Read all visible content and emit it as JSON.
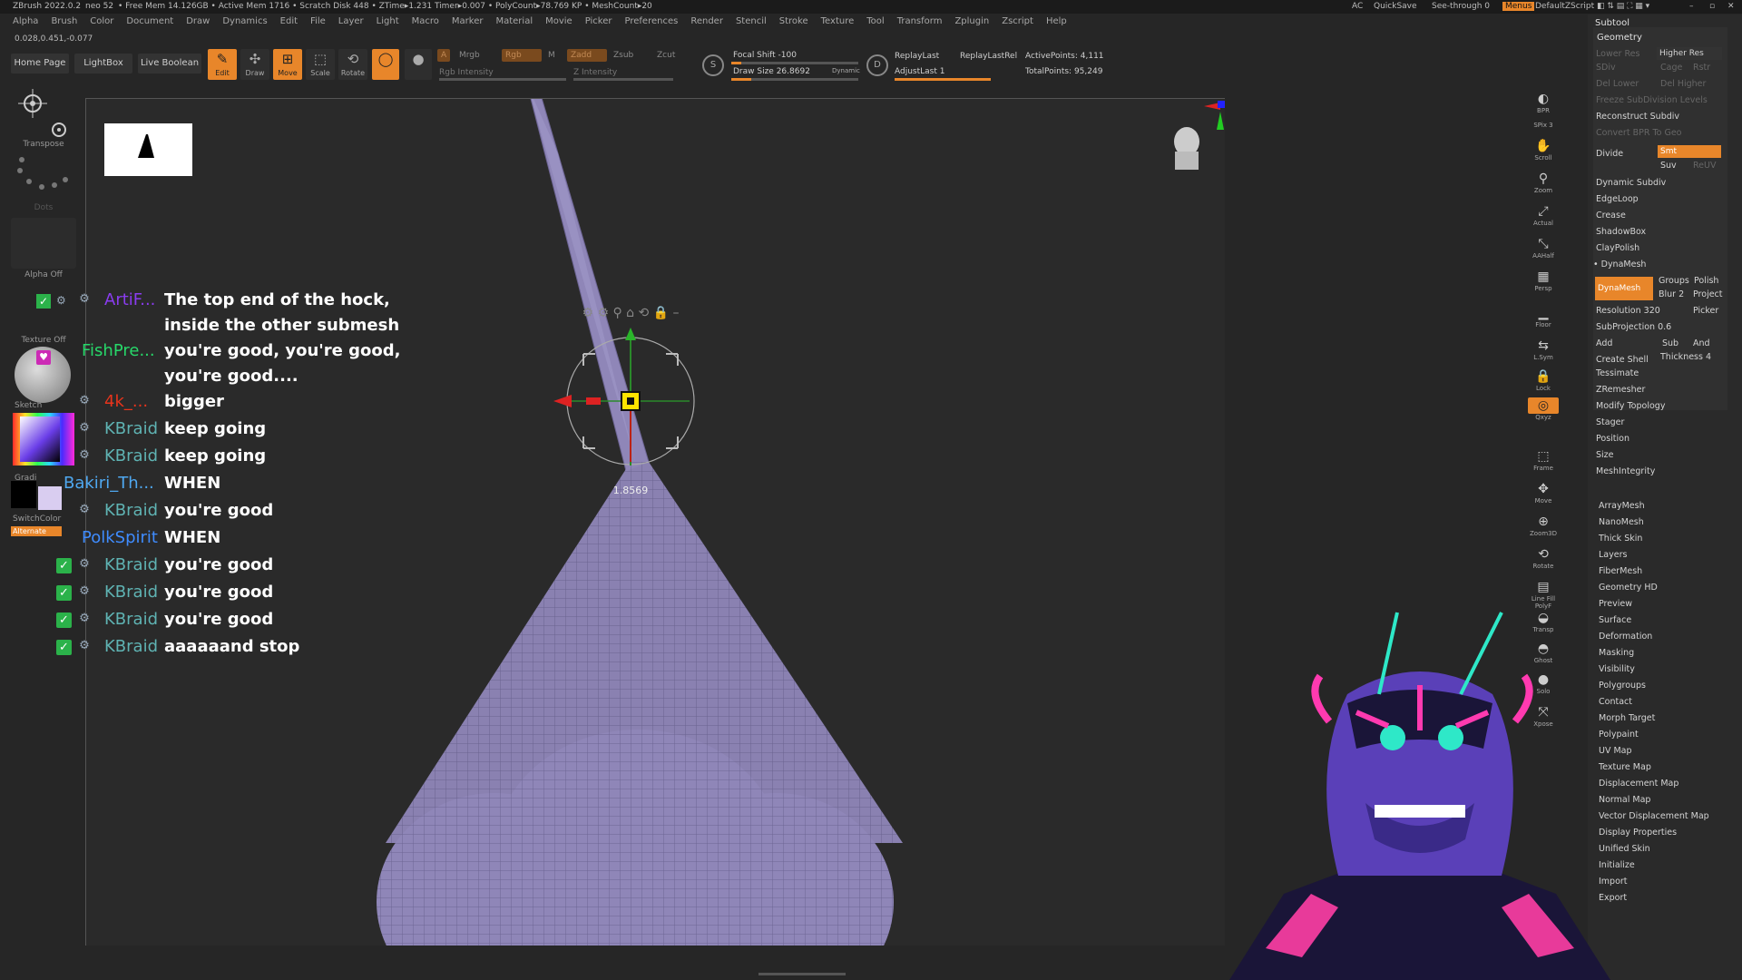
{
  "titlebar": {
    "app": "ZBrush 2022.0.2",
    "user": "neo 52",
    "stats": "• Free Mem 14.126GB • Active Mem 1716 • Scratch Disk 448 • ZTime▸1.231 Timer▸0.007 • PolyCount▸78.769 KP • MeshCount▸20",
    "ac": "AC",
    "quicksave": "QuickSave",
    "seethrough": "See-through  0",
    "menus": "Menus",
    "script": "DefaultZScript"
  },
  "menubar": [
    "Alpha",
    "Brush",
    "Color",
    "Document",
    "Draw",
    "Dynamics",
    "Edit",
    "File",
    "Layer",
    "Light",
    "Macro",
    "Marker",
    "Material",
    "Movie",
    "Picker",
    "Preferences",
    "Render",
    "Stencil",
    "Stroke",
    "Texture",
    "Tool",
    "Transform",
    "Zplugin",
    "Zscript",
    "Help"
  ],
  "coords": "0.028,0.451,-0.077",
  "toolbar": {
    "home_page": "Home Page",
    "lightbox": "LightBox",
    "live_boolean": "Live Boolean",
    "edit": "Edit",
    "draw": "Draw",
    "move": "Move",
    "scale": "Scale",
    "rotate": "Rotate",
    "a_btn": "A",
    "mrgb": "Mrgb",
    "rgb": "Rgb",
    "m": "M",
    "zadd": "Zadd",
    "zsub": "Zsub",
    "zcut": "Zcut",
    "rgb_intensity": "Rgb Intensity",
    "z_intensity": "Z Intensity",
    "focal_shift": "Focal Shift -100",
    "draw_size": "Draw Size 26.8692",
    "dynamic": "Dynamic",
    "replay_last": "ReplayLast",
    "replay_last_rel": "ReplayLastRel",
    "adjust_last": "AdjustLast 1",
    "active_points": "ActivePoints: 4,111",
    "total_points": "TotalPoints: 95,249",
    "s_label": "S",
    "d_label": "D"
  },
  "lefttray": {
    "transpose": "Transpose",
    "dots": "Dots",
    "alpha_off": "Alpha Off",
    "texture_off": "Texture Off",
    "sketch": "Sketch",
    "gradient": "Gradi",
    "switch_color": "SwitchColor",
    "alternate": "Alternate"
  },
  "canvas": {
    "gizmo_value": "1.8569"
  },
  "chat": [
    {
      "user": "ArtiF...",
      "color": "#8a3cf0",
      "text": "The top end of the hock,",
      "badge": false
    },
    {
      "user": "",
      "color": "#ffffff",
      "text": "inside the other submesh",
      "badge": false
    },
    {
      "user": "FishPre...",
      "color": "#27d86a",
      "text": "you're good, you're good,",
      "badge": false
    },
    {
      "user": "",
      "color": "#ffffff",
      "text": "you're good....",
      "badge": false
    },
    {
      "user": "4k_...",
      "color": "#e8341c",
      "text": "bigger",
      "badge": false
    },
    {
      "user": "KBraid",
      "color": "#5fb3b3",
      "text": "keep going",
      "badge": false
    },
    {
      "user": "KBraid",
      "color": "#5fb3b3",
      "text": "keep going",
      "badge": false
    },
    {
      "user": "Bakiri_Th...",
      "color": "#4fa8f0",
      "text": "WHEN",
      "badge": false
    },
    {
      "user": "KBraid",
      "color": "#5fb3b3",
      "text": "you're good",
      "badge": false
    },
    {
      "user": "PolkSpirit",
      "color": "#3f8cff",
      "text": "WHEN",
      "badge": false
    },
    {
      "user": "KBraid",
      "color": "#5fb3b3",
      "text": "you're good",
      "badge": true
    },
    {
      "user": "KBraid",
      "color": "#5fb3b3",
      "text": "you're good",
      "badge": true
    },
    {
      "user": "KBraid",
      "color": "#5fb3b3",
      "text": "you're good",
      "badge": true
    },
    {
      "user": "KBraid",
      "color": "#5fb3b3",
      "text": "aaaaaand stop",
      "badge": true
    }
  ],
  "rightshelf": [
    "BPR",
    "SPix 3",
    "Scroll",
    "Zoom",
    "Actual",
    "AAHalf",
    "Persp",
    "Floor",
    "L.Sym",
    "Lock",
    "Qxyz",
    "Frame",
    "Move",
    "Zoom3D",
    "Rotate",
    "Line Fill PolyF",
    "Transp",
    "Ghost",
    "Solo",
    "Xpose"
  ],
  "palette": {
    "subtool": "Subtool",
    "geometry": "Geometry",
    "lower_res": "Lower Res",
    "higher_res": "Higher Res",
    "sdiv": "SDiv",
    "cage": "Cage",
    "rstr": "Rstr",
    "del_lower": "Del Lower",
    "del_higher": "Del Higher",
    "freeze": "Freeze SubDivision Levels",
    "reconstruct": "Reconstruct Subdiv",
    "convert_bpr": "Convert BPR To Geo",
    "divide": "Divide",
    "smt": "Smt",
    "suv": "Suv",
    "reuv": "ReUV",
    "dynamic_subdiv": "Dynamic Subdiv",
    "edgeloop": "EdgeLoop",
    "crease": "Crease",
    "shadowbox": "ShadowBox",
    "claypolish": "ClayPolish",
    "dynamesh_head": "DynaMesh",
    "dynamesh_btn": "DynaMesh",
    "groups": "Groups",
    "polish": "Polish",
    "blur": "Blur 2",
    "project": "Project",
    "resolution": "Resolution 320",
    "picker": "Picker",
    "subprojection": "SubProjection 0.6",
    "add": "Add",
    "sub": "Sub",
    "and": "And",
    "create_shell": "Create Shell",
    "thickness": "Thickness 4",
    "sub_items": [
      "Tessimate",
      "ZRemesher",
      "Modify Topology",
      "Stager",
      "Position",
      "Size",
      "MeshIntegrity"
    ],
    "items": [
      "ArrayMesh",
      "NanoMesh",
      "Thick Skin",
      "Layers",
      "FiberMesh",
      "Geometry HD",
      "Preview",
      "Surface",
      "Deformation",
      "Masking",
      "Visibility",
      "Polygroups",
      "Contact",
      "Morph Target",
      "Polypaint",
      "UV Map",
      "Texture Map",
      "Displacement Map",
      "Normal Map",
      "Vector Displacement Map",
      "Display Properties",
      "Unified Skin",
      "Initialize",
      "Import",
      "Export"
    ]
  },
  "colors": {
    "accent": "#e8862a",
    "mesh": "#8f86b8",
    "badge": "#2bb24a"
  }
}
